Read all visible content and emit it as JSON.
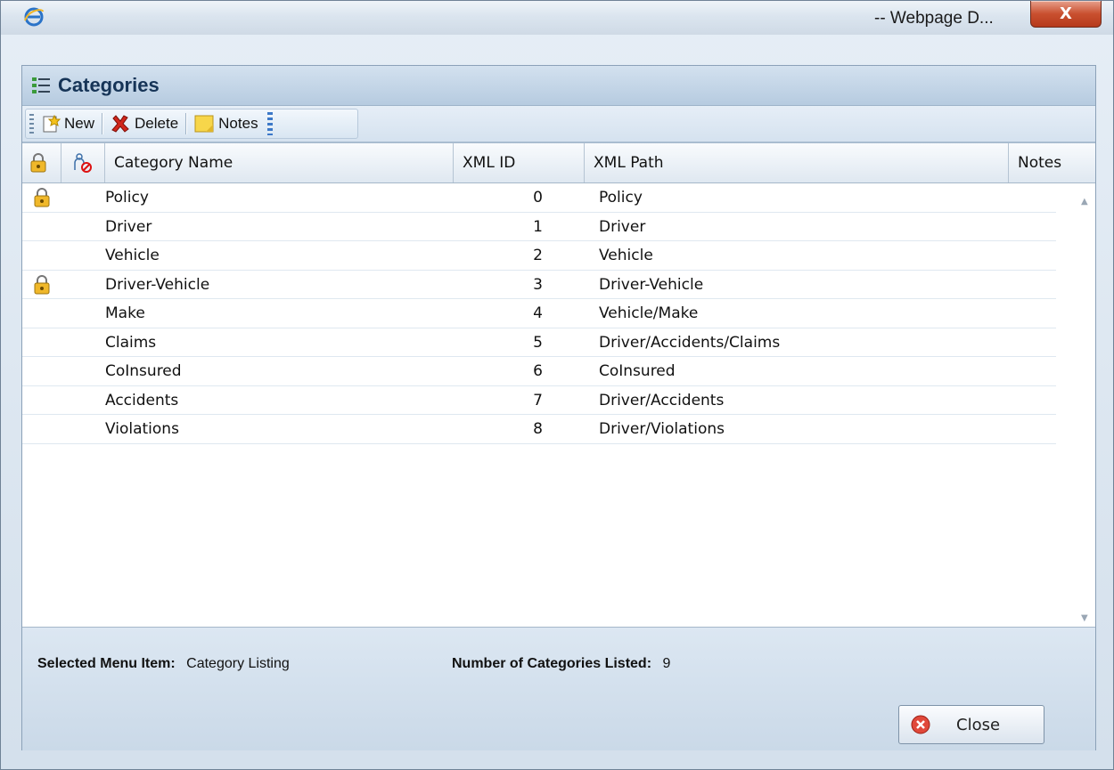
{
  "window": {
    "title": "-- Webpage D...",
    "close_glyph": "X"
  },
  "panel": {
    "title": "Categories"
  },
  "toolbar": {
    "new_label": "New",
    "delete_label": "Delete",
    "notes_label": "Notes"
  },
  "table": {
    "headers": {
      "name": "Category Name",
      "xml_id": "XML ID",
      "xml_path": "XML Path",
      "notes": "Notes"
    },
    "rows": [
      {
        "locked": true,
        "name": "Policy",
        "xml_id": "0",
        "xml_path": "Policy"
      },
      {
        "locked": false,
        "name": "Driver",
        "xml_id": "1",
        "xml_path": "Driver"
      },
      {
        "locked": false,
        "name": "Vehicle",
        "xml_id": "2",
        "xml_path": "Vehicle"
      },
      {
        "locked": true,
        "name": "Driver-Vehicle",
        "xml_id": "3",
        "xml_path": "Driver-Vehicle"
      },
      {
        "locked": false,
        "name": "Make",
        "xml_id": "4",
        "xml_path": "Vehicle/Make"
      },
      {
        "locked": false,
        "name": "Claims",
        "xml_id": "5",
        "xml_path": "Driver/Accidents/Claims"
      },
      {
        "locked": false,
        "name": "CoInsured",
        "xml_id": "6",
        "xml_path": "CoInsured"
      },
      {
        "locked": false,
        "name": "Accidents",
        "xml_id": "7",
        "xml_path": "Driver/Accidents"
      },
      {
        "locked": false,
        "name": "Violations",
        "xml_id": "8",
        "xml_path": "Driver/Violations"
      }
    ]
  },
  "footer": {
    "selected_label": "Selected Menu Item:",
    "selected_value": "Category Listing",
    "count_label": "Number of Categories Listed:",
    "count_value": "9",
    "close_label": "Close"
  },
  "colors": {
    "header_blue": "#163457",
    "close_red": "#c9502f"
  }
}
